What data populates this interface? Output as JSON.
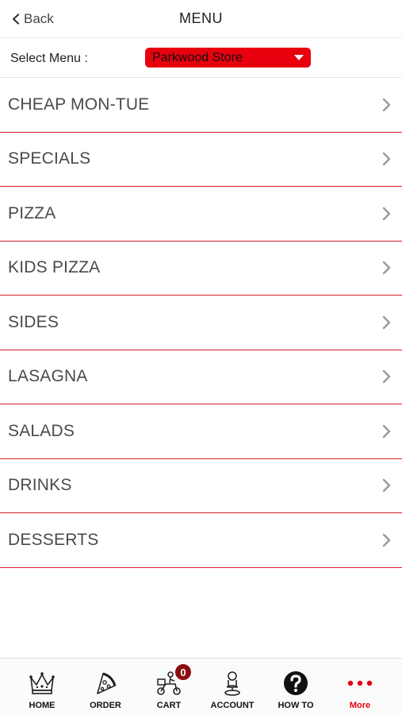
{
  "header": {
    "back_label": "Back",
    "title": "MENU"
  },
  "select_menu": {
    "label": "Select Menu :",
    "value": "Parkwood Store"
  },
  "menu": {
    "items": [
      {
        "label": "CHEAP MON-TUE"
      },
      {
        "label": "SPECIALS"
      },
      {
        "label": "PIZZA"
      },
      {
        "label": "KIDS PIZZA"
      },
      {
        "label": "SIDES"
      },
      {
        "label": "LASAGNA"
      },
      {
        "label": "SALADS"
      },
      {
        "label": "DRINKS"
      },
      {
        "label": "DESSERTS"
      }
    ]
  },
  "tabs": {
    "home": {
      "label": "HOME",
      "icon": "crown-icon"
    },
    "order": {
      "label": "ORDER",
      "icon": "pizza-slice-icon"
    },
    "cart": {
      "label": "CART",
      "icon": "delivery-scooter-icon",
      "badge": "0"
    },
    "account": {
      "label": "ACCOUNT",
      "icon": "person-icon"
    },
    "howto": {
      "label": "HOW TO",
      "icon": "question-icon"
    },
    "more": {
      "label": "More",
      "icon": "more-dots-icon",
      "active": true
    }
  },
  "colors": {
    "accent": "#e8000e",
    "divider": "#d8202a",
    "badge": "#8b0d12"
  }
}
